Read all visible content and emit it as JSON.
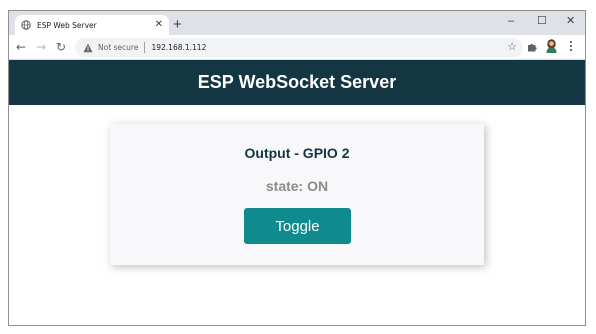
{
  "browser": {
    "tab_title": "ESP Web Server",
    "tab_close": "✕",
    "new_tab": "+",
    "minimize": "–",
    "maximize": "☐",
    "close": "✕",
    "back": "←",
    "forward": "→",
    "reload": "↻",
    "security_label": "Not secure",
    "url": "192.168.1.112",
    "bookmark_star": "☆"
  },
  "page": {
    "header_title": "ESP WebSocket Server",
    "card_title": "Output - GPIO 2",
    "state_label": "state: ",
    "state_value": "ON",
    "toggle_label": "Toggle"
  },
  "colors": {
    "header_bg": "#143642",
    "card_title": "#143642",
    "button_bg": "#0f8b8d",
    "state_text": "#8c8c8c"
  }
}
